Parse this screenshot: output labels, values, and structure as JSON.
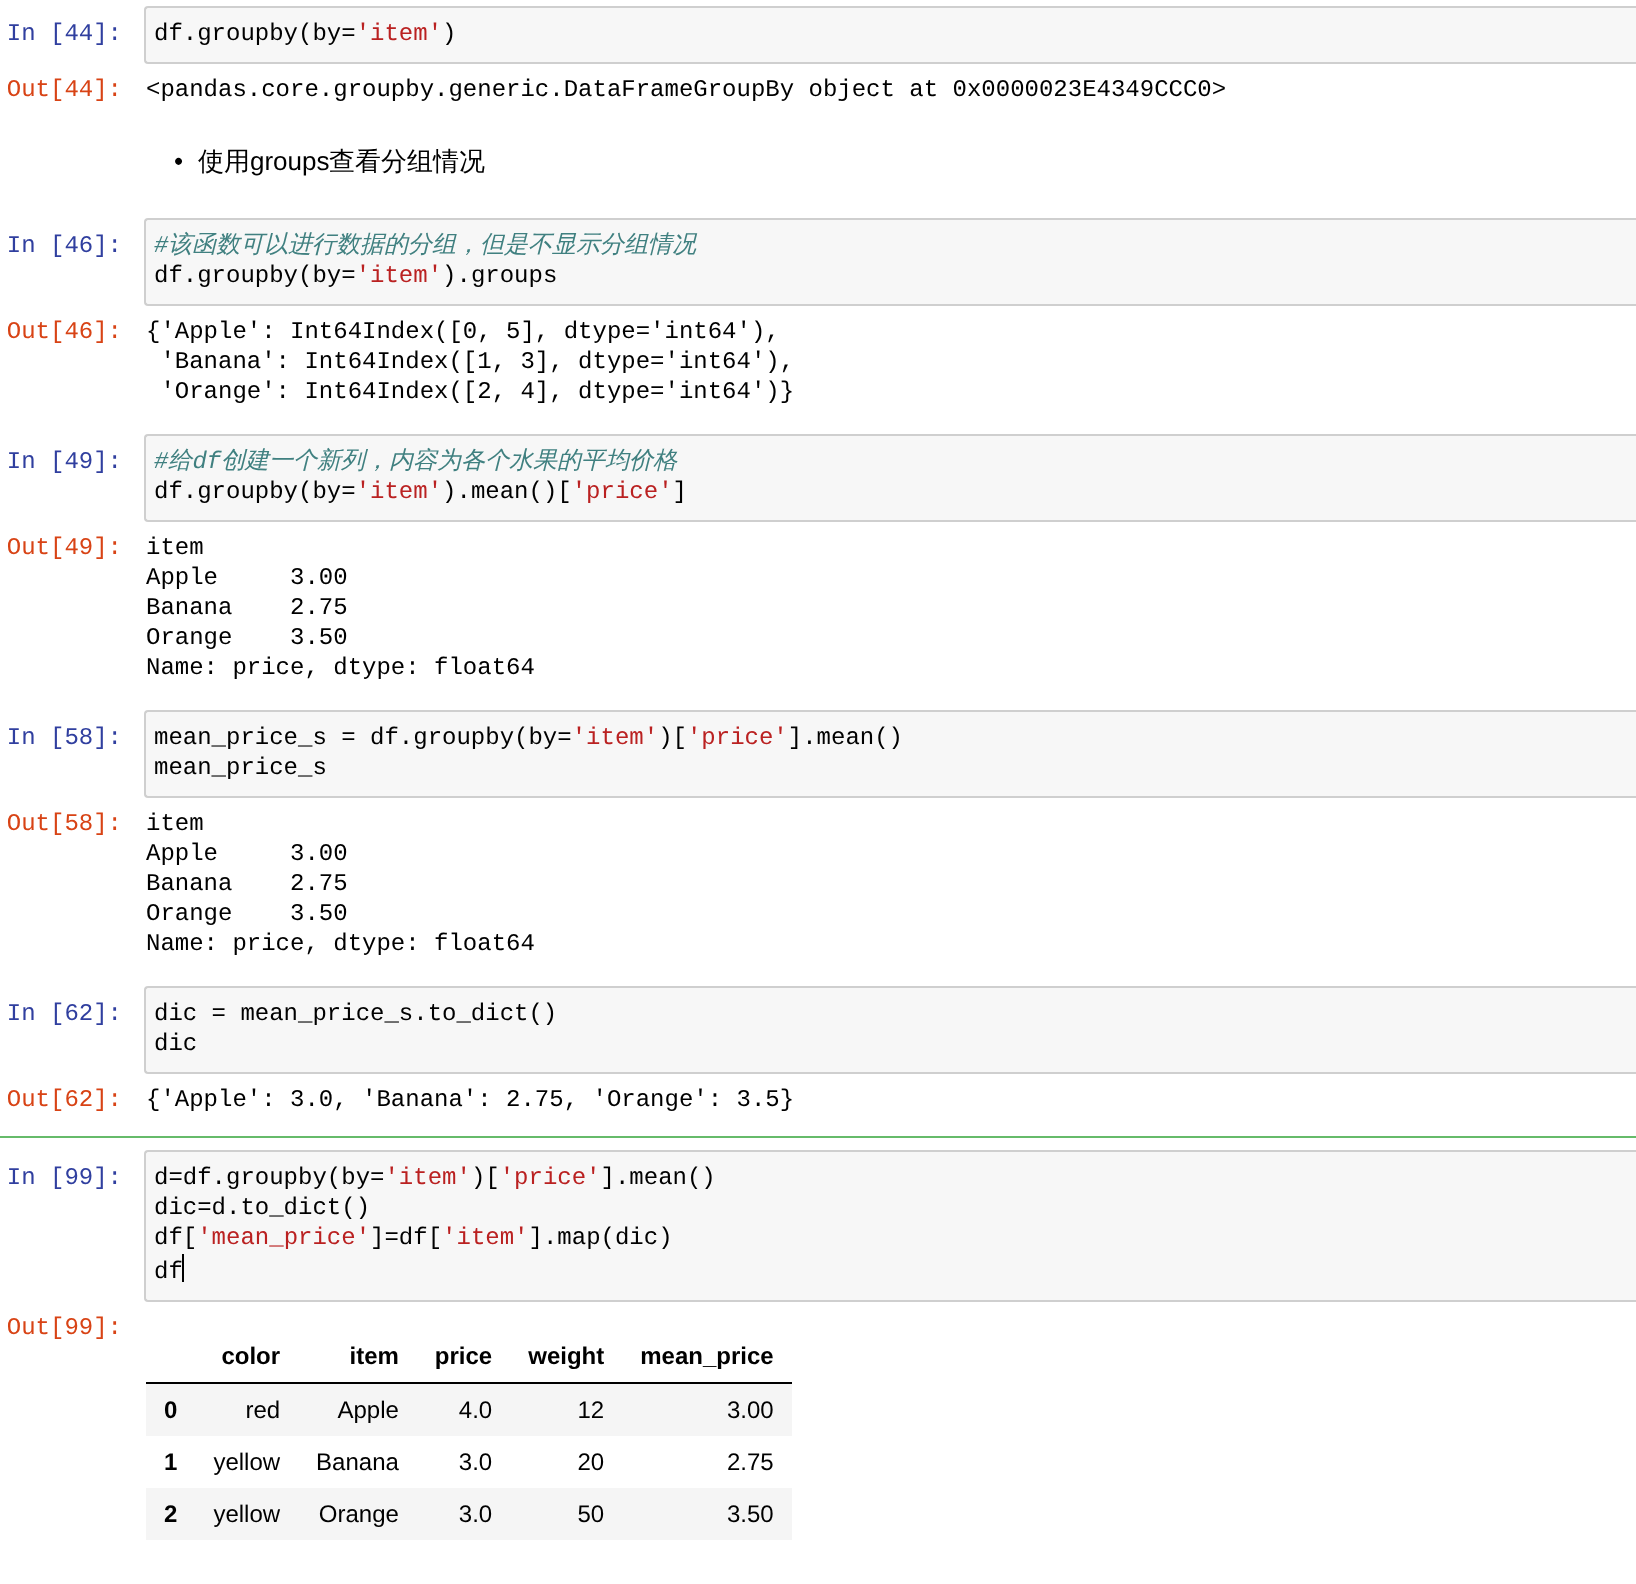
{
  "cells": [
    {
      "kind": "code",
      "selected": false,
      "editing": false,
      "prompt_in": "In [44]:",
      "input": [
        [
          {
            "kind": "plain",
            "text": "df.groupby(by="
          },
          {
            "kind": "string",
            "text": "'item'"
          },
          {
            "kind": "plain",
            "text": ")"
          }
        ]
      ],
      "prompt_out": "Out[44]:",
      "output": {
        "kind": "text",
        "lines": [
          "<pandas.core.groupby.generic.DataFrameGroupBy object at 0x0000023E4349CCC0>"
        ]
      }
    },
    {
      "kind": "markdown",
      "selected": false,
      "bullets": [
        {
          "marker": "•",
          "text": "使用groups查看分组情况"
        }
      ]
    },
    {
      "kind": "code",
      "selected": false,
      "editing": false,
      "prompt_in": "In [46]:",
      "input": [
        [
          {
            "kind": "comment",
            "text": "#该函数可以进行数据的分组，但是不显示分组情况"
          }
        ],
        [
          {
            "kind": "plain",
            "text": "df.groupby(by="
          },
          {
            "kind": "string",
            "text": "'item'"
          },
          {
            "kind": "plain",
            "text": ").groups"
          }
        ]
      ],
      "prompt_out": "Out[46]:",
      "output": {
        "kind": "text",
        "lines": [
          "{'Apple': Int64Index([0, 5], dtype='int64'),",
          " 'Banana': Int64Index([1, 3], dtype='int64'),",
          " 'Orange': Int64Index([2, 4], dtype='int64')}"
        ]
      }
    },
    {
      "kind": "code",
      "selected": false,
      "editing": false,
      "prompt_in": "In [49]:",
      "input": [
        [
          {
            "kind": "comment",
            "text": "#给df创建一个新列，内容为各个水果的平均价格"
          }
        ],
        [
          {
            "kind": "plain",
            "text": "df.groupby(by="
          },
          {
            "kind": "string",
            "text": "'item'"
          },
          {
            "kind": "plain",
            "text": ").mean()["
          },
          {
            "kind": "string",
            "text": "'price'"
          },
          {
            "kind": "plain",
            "text": "]"
          }
        ]
      ],
      "prompt_out": "Out[49]:",
      "output": {
        "kind": "text",
        "lines": [
          "item",
          "Apple     3.00",
          "Banana    2.75",
          "Orange    3.50",
          "Name: price, dtype: float64"
        ]
      }
    },
    {
      "kind": "code",
      "selected": false,
      "editing": false,
      "prompt_in": "In [58]:",
      "input": [
        [
          {
            "kind": "plain",
            "text": "mean_price_s = df.groupby(by="
          },
          {
            "kind": "string",
            "text": "'item'"
          },
          {
            "kind": "plain",
            "text": ")["
          },
          {
            "kind": "string",
            "text": "'price'"
          },
          {
            "kind": "plain",
            "text": "].mean()"
          }
        ],
        [
          {
            "kind": "plain",
            "text": "mean_price_s"
          }
        ]
      ],
      "prompt_out": "Out[58]:",
      "output": {
        "kind": "text",
        "lines": [
          "item",
          "Apple     3.00",
          "Banana    2.75",
          "Orange    3.50",
          "Name: price, dtype: float64"
        ]
      }
    },
    {
      "kind": "code",
      "selected": false,
      "editing": false,
      "prompt_in": "In [62]:",
      "input": [
        [
          {
            "kind": "plain",
            "text": "dic = mean_price_s.to_dict()"
          }
        ],
        [
          {
            "kind": "plain",
            "text": "dic"
          }
        ]
      ],
      "prompt_out": "Out[62]:",
      "output": {
        "kind": "text",
        "lines": [
          "{'Apple': 3.0, 'Banana': 2.75, 'Orange': 3.5}"
        ]
      }
    },
    {
      "kind": "code",
      "selected": true,
      "editing": true,
      "prompt_in": "In [99]:",
      "input": [
        [
          {
            "kind": "plain",
            "text": "d=df.groupby(by="
          },
          {
            "kind": "string",
            "text": "'item'"
          },
          {
            "kind": "plain",
            "text": ")["
          },
          {
            "kind": "string",
            "text": "'price'"
          },
          {
            "kind": "plain",
            "text": "].mean()"
          }
        ],
        [
          {
            "kind": "plain",
            "text": "dic=d.to_dict()"
          }
        ],
        [
          {
            "kind": "plain",
            "text": "df["
          },
          {
            "kind": "string",
            "text": "'mean_price'"
          },
          {
            "kind": "plain",
            "text": "]=df["
          },
          {
            "kind": "string",
            "text": "'item'"
          },
          {
            "kind": "plain",
            "text": "].map(dic)"
          }
        ],
        [
          {
            "kind": "plain",
            "text": "df"
          }
        ]
      ],
      "prompt_out": "Out[99]:",
      "output": {
        "kind": "table",
        "columns": [
          "",
          "color",
          "item",
          "price",
          "weight",
          "mean_price"
        ],
        "rows": [
          [
            "0",
            "red",
            "Apple",
            "4.0",
            "12",
            "3.00"
          ],
          [
            "1",
            "yellow",
            "Banana",
            "3.0",
            "20",
            "2.75"
          ],
          [
            "2",
            "yellow",
            "Orange",
            "3.0",
            "50",
            "3.50"
          ]
        ]
      }
    }
  ]
}
